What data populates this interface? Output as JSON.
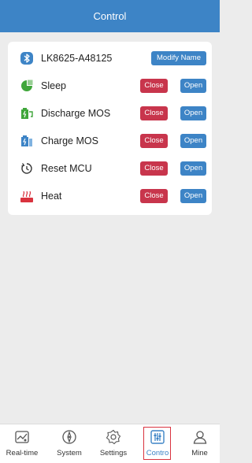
{
  "header": {
    "title": "Control"
  },
  "device": {
    "name": "LK8625-A48125",
    "modify_label": "Modify Name",
    "icon": "bluetooth-icon"
  },
  "controls": [
    {
      "label": "Sleep",
      "icon": "sleep-icon",
      "close": "Close",
      "open": "Open"
    },
    {
      "label": "Discharge MOS",
      "icon": "discharge-icon",
      "close": "Close",
      "open": "Open"
    },
    {
      "label": "Charge MOS",
      "icon": "charge-icon",
      "close": "Close",
      "open": "Open"
    },
    {
      "label": "Reset MCU",
      "icon": "reset-icon",
      "close": "Close",
      "open": "Open"
    },
    {
      "label": "Heat",
      "icon": "heat-icon",
      "close": "Close",
      "open": "Open"
    }
  ],
  "tabs": [
    {
      "label": "Real-time",
      "icon": "realtime-icon"
    },
    {
      "label": "System",
      "icon": "system-icon"
    },
    {
      "label": "Settings",
      "icon": "settings-icon"
    },
    {
      "label": "Contro",
      "icon": "control-icon",
      "active": true
    },
    {
      "label": "Mine",
      "icon": "user-icon"
    }
  ],
  "colors": {
    "primary": "#3d84c6",
    "danger": "#c8354c",
    "green": "#3fa63a",
    "heat": "#d9333f"
  }
}
